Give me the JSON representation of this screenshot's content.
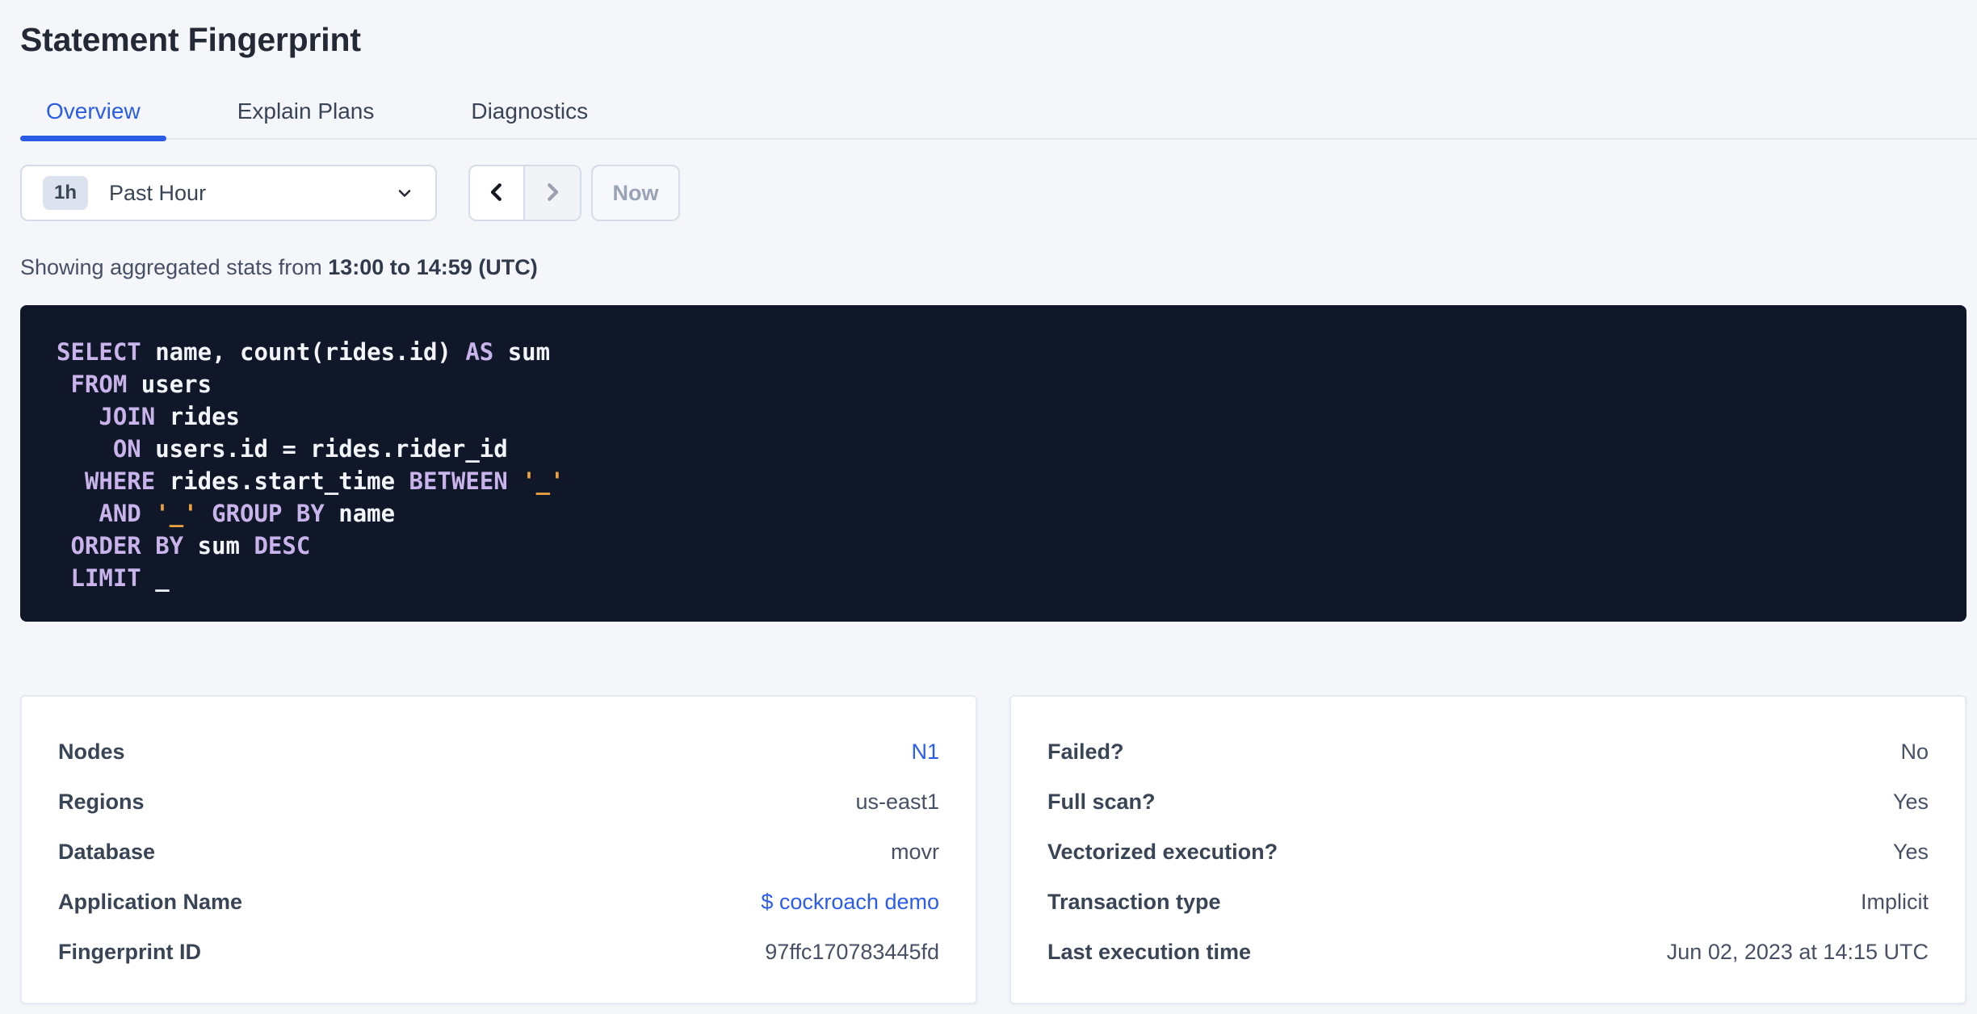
{
  "colors": {
    "background": "#f4f6fa",
    "accent_blue": "#2a5ce6",
    "link_blue": "#2a5cf0",
    "sql_background": "#0f1729",
    "sql_keyword": "#c8b3ea",
    "sql_string": "#eda23f",
    "sql_plain": "#f2f4f8"
  },
  "page": {
    "title": "Statement Fingerprint"
  },
  "tabs": [
    {
      "label": "Overview",
      "active": true
    },
    {
      "label": "Explain Plans",
      "active": false
    },
    {
      "label": "Diagnostics",
      "active": false
    }
  ],
  "time_picker": {
    "badge": "1h",
    "label": "Past Hour",
    "now_label": "Now",
    "prev_enabled": true,
    "next_enabled": false
  },
  "stats": {
    "prefix": "Showing aggregated stats from ",
    "range": "13:00 to 14:59 (UTC)"
  },
  "sql": {
    "lines": [
      [
        {
          "t": "kw",
          "v": "SELECT"
        },
        {
          "t": "id",
          "v": " name, count(rides.id) "
        },
        {
          "t": "kw",
          "v": "AS"
        },
        {
          "t": "id",
          "v": " sum"
        }
      ],
      [
        {
          "t": "id",
          "v": " "
        },
        {
          "t": "kw",
          "v": "FROM"
        },
        {
          "t": "id",
          "v": " users"
        }
      ],
      [
        {
          "t": "id",
          "v": "   "
        },
        {
          "t": "kw",
          "v": "JOIN"
        },
        {
          "t": "id",
          "v": " rides"
        }
      ],
      [
        {
          "t": "id",
          "v": "    "
        },
        {
          "t": "kw",
          "v": "ON"
        },
        {
          "t": "id",
          "v": " users.id = rides.rider_id"
        }
      ],
      [
        {
          "t": "id",
          "v": "  "
        },
        {
          "t": "kw",
          "v": "WHERE"
        },
        {
          "t": "id",
          "v": " rides.start_time "
        },
        {
          "t": "kw",
          "v": "BETWEEN"
        },
        {
          "t": "id",
          "v": " "
        },
        {
          "t": "str",
          "v": "'_'"
        }
      ],
      [
        {
          "t": "id",
          "v": "   "
        },
        {
          "t": "kw",
          "v": "AND"
        },
        {
          "t": "id",
          "v": " "
        },
        {
          "t": "str",
          "v": "'_'"
        },
        {
          "t": "id",
          "v": " "
        },
        {
          "t": "kw",
          "v": "GROUP BY"
        },
        {
          "t": "id",
          "v": " name"
        }
      ],
      [
        {
          "t": "id",
          "v": " "
        },
        {
          "t": "kw",
          "v": "ORDER BY"
        },
        {
          "t": "id",
          "v": " sum "
        },
        {
          "t": "kw",
          "v": "DESC"
        }
      ],
      [
        {
          "t": "id",
          "v": " "
        },
        {
          "t": "kw",
          "v": "LIMIT"
        },
        {
          "t": "id",
          "v": " _"
        }
      ]
    ]
  },
  "cards": {
    "left": {
      "rows": [
        {
          "label": "Nodes",
          "value": "N1",
          "link": true
        },
        {
          "label": "Regions",
          "value": "us-east1",
          "link": false
        },
        {
          "label": "Database",
          "value": "movr",
          "link": false
        },
        {
          "label": "Application Name",
          "value": "$ cockroach demo",
          "link": true
        },
        {
          "label": "Fingerprint ID",
          "value": "97ffc170783445fd",
          "link": false
        }
      ]
    },
    "right": {
      "rows": [
        {
          "label": "Failed?",
          "value": "No",
          "link": false
        },
        {
          "label": "Full scan?",
          "value": "Yes",
          "link": false
        },
        {
          "label": "Vectorized execution?",
          "value": "Yes",
          "link": false
        },
        {
          "label": "Transaction type",
          "value": "Implicit",
          "link": false
        },
        {
          "label": "Last execution time",
          "value": "Jun 02, 2023 at 14:15 UTC",
          "link": false
        }
      ]
    }
  }
}
